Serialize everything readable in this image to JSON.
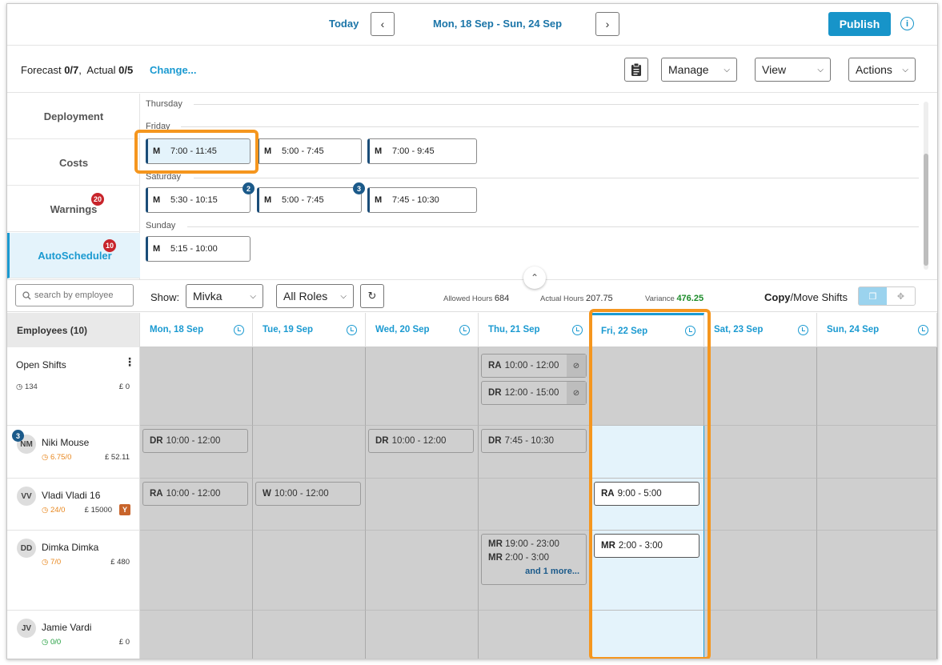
{
  "header": {
    "today_label": "Today",
    "date_range": "Mon, 18 Sep - Sun, 24 Sep",
    "publish_label": "Publish",
    "prev_icon": "chevron-left-icon",
    "next_icon": "chevron-right-icon",
    "info_icon": "info-icon"
  },
  "subheader": {
    "forecast_label": "Forecast",
    "forecast_value": "0/7",
    "actual_label": "Actual",
    "actual_value": "0/5",
    "change_link": "Change...",
    "manage_label": "Manage",
    "view_label": "View",
    "actions_label": "Actions"
  },
  "left_nav": {
    "items": [
      {
        "label": "Deployment"
      },
      {
        "label": "Costs"
      },
      {
        "label": "Warnings",
        "badge": "20"
      },
      {
        "label": "AutoScheduler",
        "badge": "10"
      }
    ]
  },
  "autoscheduler": {
    "days": [
      {
        "label": "Thursday"
      },
      {
        "label": "Friday"
      },
      {
        "label": "Saturday"
      },
      {
        "label": "Sunday"
      }
    ],
    "friday_shifts": [
      {
        "role": "M",
        "time": "7:00 - 11:45"
      },
      {
        "role": "M",
        "time": "5:00 - 7:45"
      },
      {
        "role": "M",
        "time": "7:00 - 9:45"
      }
    ],
    "saturday_shifts": [
      {
        "role": "M",
        "time": "5:30 - 10:15",
        "count": "2"
      },
      {
        "role": "M",
        "time": "5:00 - 7:45",
        "count": "3"
      },
      {
        "role": "M",
        "time": "7:45 - 10:30"
      }
    ],
    "sunday_shifts": [
      {
        "role": "M",
        "time": "5:15 - 10:00"
      }
    ]
  },
  "toolbar": {
    "search_placeholder": "search by employee",
    "show_label": "Show:",
    "show_value": "Mivka",
    "roles_value": "All Roles",
    "allowed_hours_label": "Allowed Hours",
    "allowed_hours_value": "684",
    "actual_hours_label": "Actual Hours",
    "actual_hours_value": "207.75",
    "variance_label": "Variance",
    "variance_value": "476.25",
    "copy_label": "Copy",
    "move_label": "/Move Shifts"
  },
  "grid": {
    "employees_header": "Employees (10)",
    "days": [
      {
        "label": "Mon, 18 Sep"
      },
      {
        "label": "Tue, 19 Sep"
      },
      {
        "label": "Wed, 20 Sep"
      },
      {
        "label": "Thu, 21 Sep"
      },
      {
        "label": "Fri, 22 Sep"
      },
      {
        "label": "Sat, 23 Sep"
      },
      {
        "label": "Sun, 24 Sep"
      }
    ],
    "open_shifts": {
      "label": "Open Shifts",
      "hours": "134",
      "cost": "£ 0",
      "shifts": [
        {
          "role": "RA",
          "time": "10:00 - 12:00"
        },
        {
          "role": "DR",
          "time": "12:00 - 15:00"
        }
      ]
    },
    "employees": [
      {
        "initials": "NM",
        "name": "Niki Mouse",
        "hours": "6.75/0",
        "cost": "£ 52.11",
        "badge": "3"
      },
      {
        "initials": "VV",
        "name": "Vladi Vladi 16",
        "hours": "24/0",
        "cost": "£ 15000",
        "tag": "Y"
      },
      {
        "initials": "DD",
        "name": "Dimka Dimka",
        "hours": "7/0",
        "cost": "£ 480"
      },
      {
        "initials": "JV",
        "name": "Jamie Vardi",
        "hours": "0/0",
        "cost": "£ 0"
      }
    ],
    "niki_shifts": {
      "mon": {
        "role": "DR",
        "time": "10:00 - 12:00"
      },
      "wed": {
        "role": "DR",
        "time": "10:00 - 12:00"
      },
      "thu": {
        "role": "DR",
        "time": "7:45 - 10:30"
      }
    },
    "vladi_shifts": {
      "mon": {
        "role": "RA",
        "time": "10:00 - 12:00"
      },
      "tue": {
        "role": "W",
        "time": "10:00 - 12:00"
      },
      "fri": {
        "role": "RA",
        "time": "9:00 - 5:00"
      }
    },
    "dimka_shifts": {
      "thu1": {
        "role": "MR",
        "time": "19:00 - 23:00"
      },
      "thu2": {
        "role": "MR",
        "time": "2:00 - 3:00"
      },
      "thu_more": "and 1 more...",
      "fri": {
        "role": "MR",
        "time": "2:00 - 3:00"
      }
    }
  }
}
